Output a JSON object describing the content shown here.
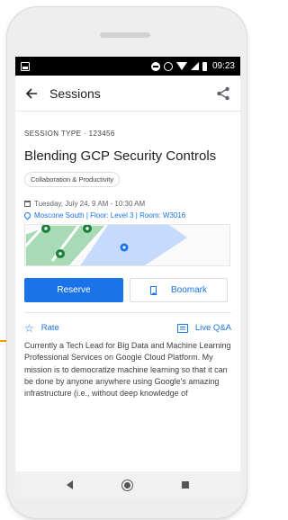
{
  "status_bar": {
    "time": "09:23"
  },
  "app_bar": {
    "title": "Sessions"
  },
  "session": {
    "type_label": "SESSION TYPE · 123456",
    "title": "Blending GCP Security Controls",
    "tag": "Collaboration & Productivity",
    "datetime": "Tuesday, July 24, 9 AM - 10:30 AM",
    "location": "Moscone South | Floor: Level 3 | Room: W3016",
    "description": "Currently a Tech Lead for Big Data and Machine Learning Professional Services on Google Cloud Platform.  My mission is to democratize machine learning so that it can be done by anyone anywhere using Google's amazing infrastructure (i.e., without deep knowledge of"
  },
  "actions": {
    "reserve_label": "Reserve",
    "bookmark_label": "Boomark"
  },
  "links": {
    "rate_label": "Rate",
    "live_qa_label": "Live Q&A"
  },
  "colors": {
    "accent": "#1a73e8",
    "map_green": "#a8dab5",
    "map_blue": "#c6dafc",
    "marker_green": "#188038",
    "connector": "#f29900"
  },
  "icons": {
    "back": "arrow-left-icon",
    "share": "share-icon",
    "calendar": "calendar-icon",
    "location": "location-pin-icon",
    "bookmark": "bookmark-icon",
    "rate": "star-outline-icon",
    "live_qa": "chat-icon"
  }
}
